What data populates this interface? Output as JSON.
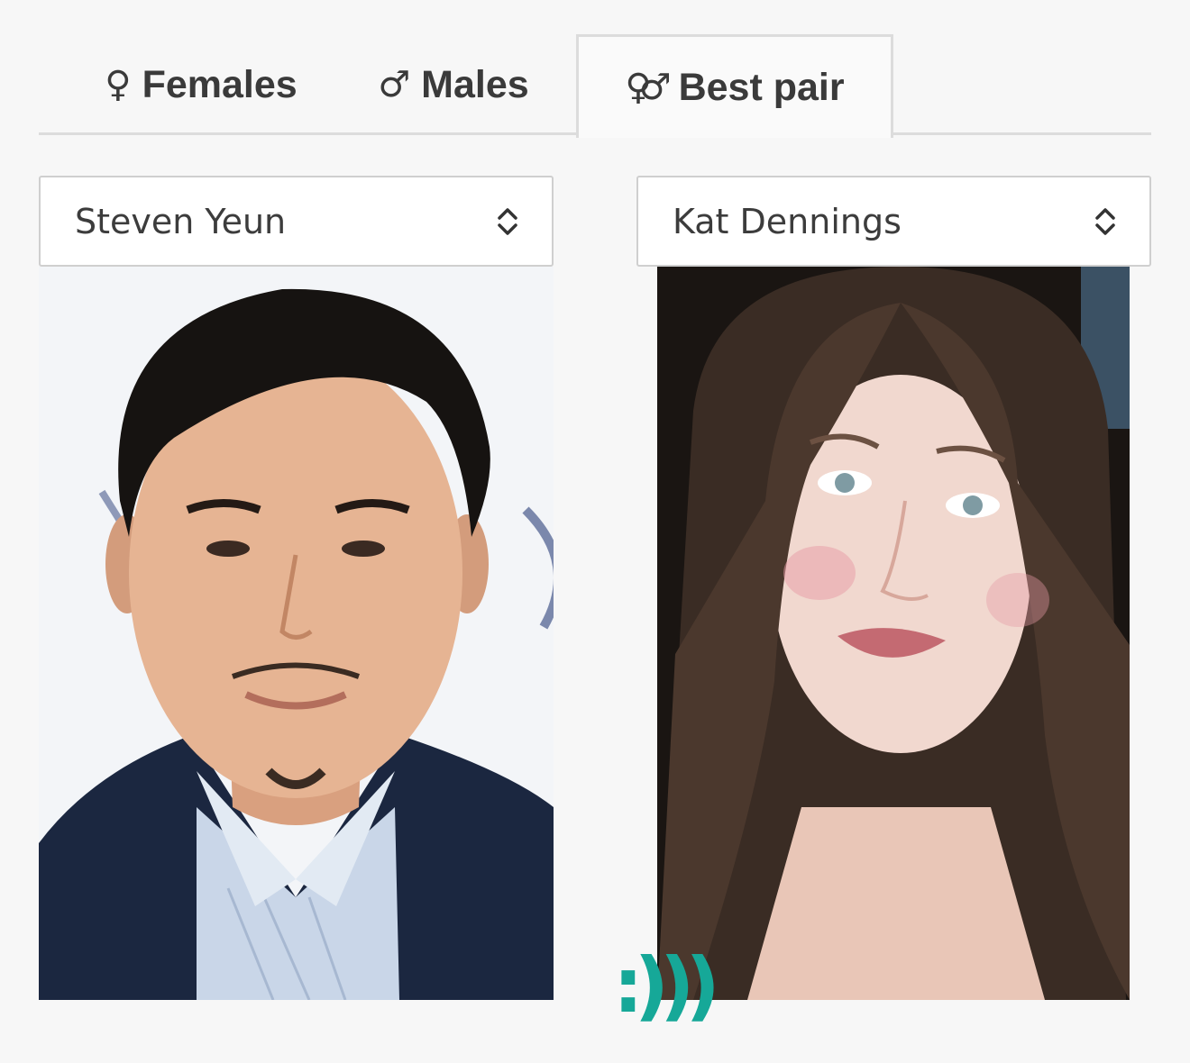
{
  "tabs": [
    {
      "symbol": "♀",
      "label": "Females",
      "active": false
    },
    {
      "symbol": "♂",
      "label": "Males",
      "active": false
    },
    {
      "symbol": "⚤",
      "label": "Best pair",
      "active": true
    }
  ],
  "selects": {
    "left": {
      "value": "Steven Yeun"
    },
    "right": {
      "value": "Kat Dennings"
    }
  },
  "photos": {
    "left": {
      "subject": "man-portrait"
    },
    "right": {
      "subject": "woman-portrait"
    }
  },
  "logo": {
    "text": ":)))",
    "color": "#16a898"
  },
  "colors": {
    "tab_text": "#3a3a3a",
    "border": "#dcdcdc",
    "background": "#f7f7f7"
  }
}
